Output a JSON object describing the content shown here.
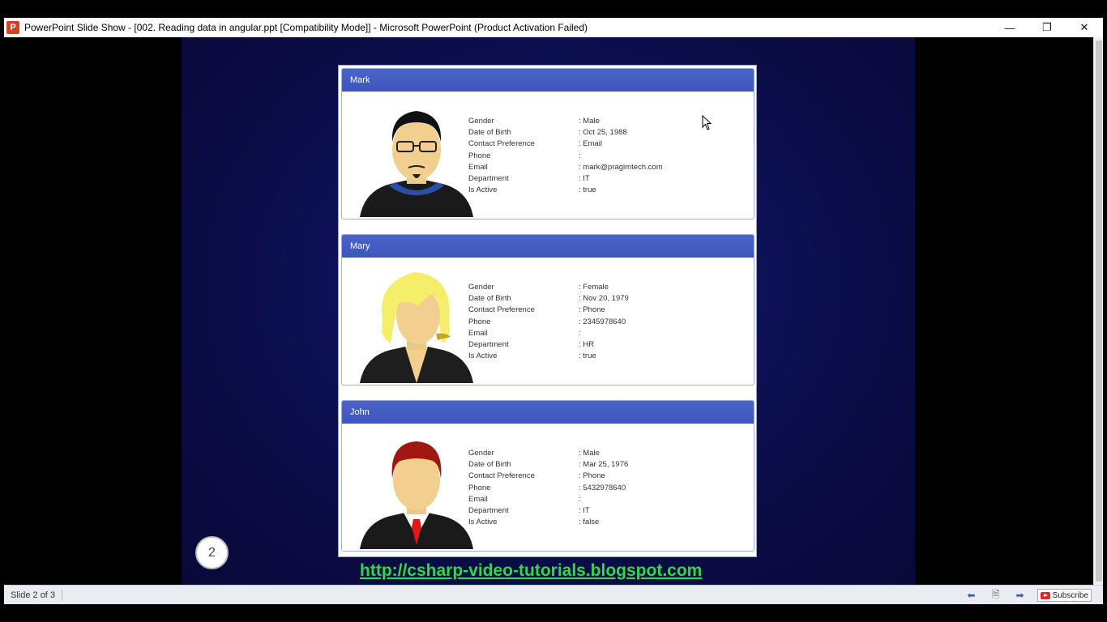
{
  "window": {
    "app_icon_letter": "P",
    "title": "PowerPoint Slide Show - [002. Reading data in angular.ppt [Compatibility Mode]] - Microsoft PowerPoint (Product Activation Failed)",
    "minimize": "—",
    "restore": "❐",
    "close": "✕"
  },
  "slide": {
    "number": "2",
    "link": "http://csharp-video-tutorials.blogspot.com",
    "employees": [
      {
        "name": "Mark",
        "fields": [
          {
            "label": "Gender",
            "value": ": Male"
          },
          {
            "label": "Date of Birth",
            "value": ": Oct 25, 1988"
          },
          {
            "label": "Contact Preference",
            "value": ": Email"
          },
          {
            "label": "Phone",
            "value": ":"
          },
          {
            "label": "Email",
            "value": ": mark@pragimtech.com"
          },
          {
            "label": "Department",
            "value": ": IT"
          },
          {
            "label": "Is Active",
            "value": ": true"
          }
        ]
      },
      {
        "name": "Mary",
        "fields": [
          {
            "label": "Gender",
            "value": ": Female"
          },
          {
            "label": "Date of Birth",
            "value": ": Nov 20, 1979"
          },
          {
            "label": "Contact Preference",
            "value": ": Phone"
          },
          {
            "label": "Phone",
            "value": ": 2345978640"
          },
          {
            "label": "Email",
            "value": ":"
          },
          {
            "label": "Department",
            "value": ": HR"
          },
          {
            "label": "Is Active",
            "value": ": true"
          }
        ]
      },
      {
        "name": "John",
        "fields": [
          {
            "label": "Gender",
            "value": ": Male"
          },
          {
            "label": "Date of Birth",
            "value": ": Mar 25, 1976"
          },
          {
            "label": "Contact Preference",
            "value": ": Phone"
          },
          {
            "label": "Phone",
            "value": ": 5432978640"
          },
          {
            "label": "Email",
            "value": ":"
          },
          {
            "label": "Department",
            "value": ": IT"
          },
          {
            "label": "Is Active",
            "value": ": false"
          }
        ]
      }
    ]
  },
  "statusbar": {
    "slide_indicator": "Slide 2 of 3",
    "subscribe": "Subscribe"
  },
  "colors": {
    "card_header": "#4a63c8",
    "link": "#35d64a",
    "slide_bg": "#0e125a"
  }
}
